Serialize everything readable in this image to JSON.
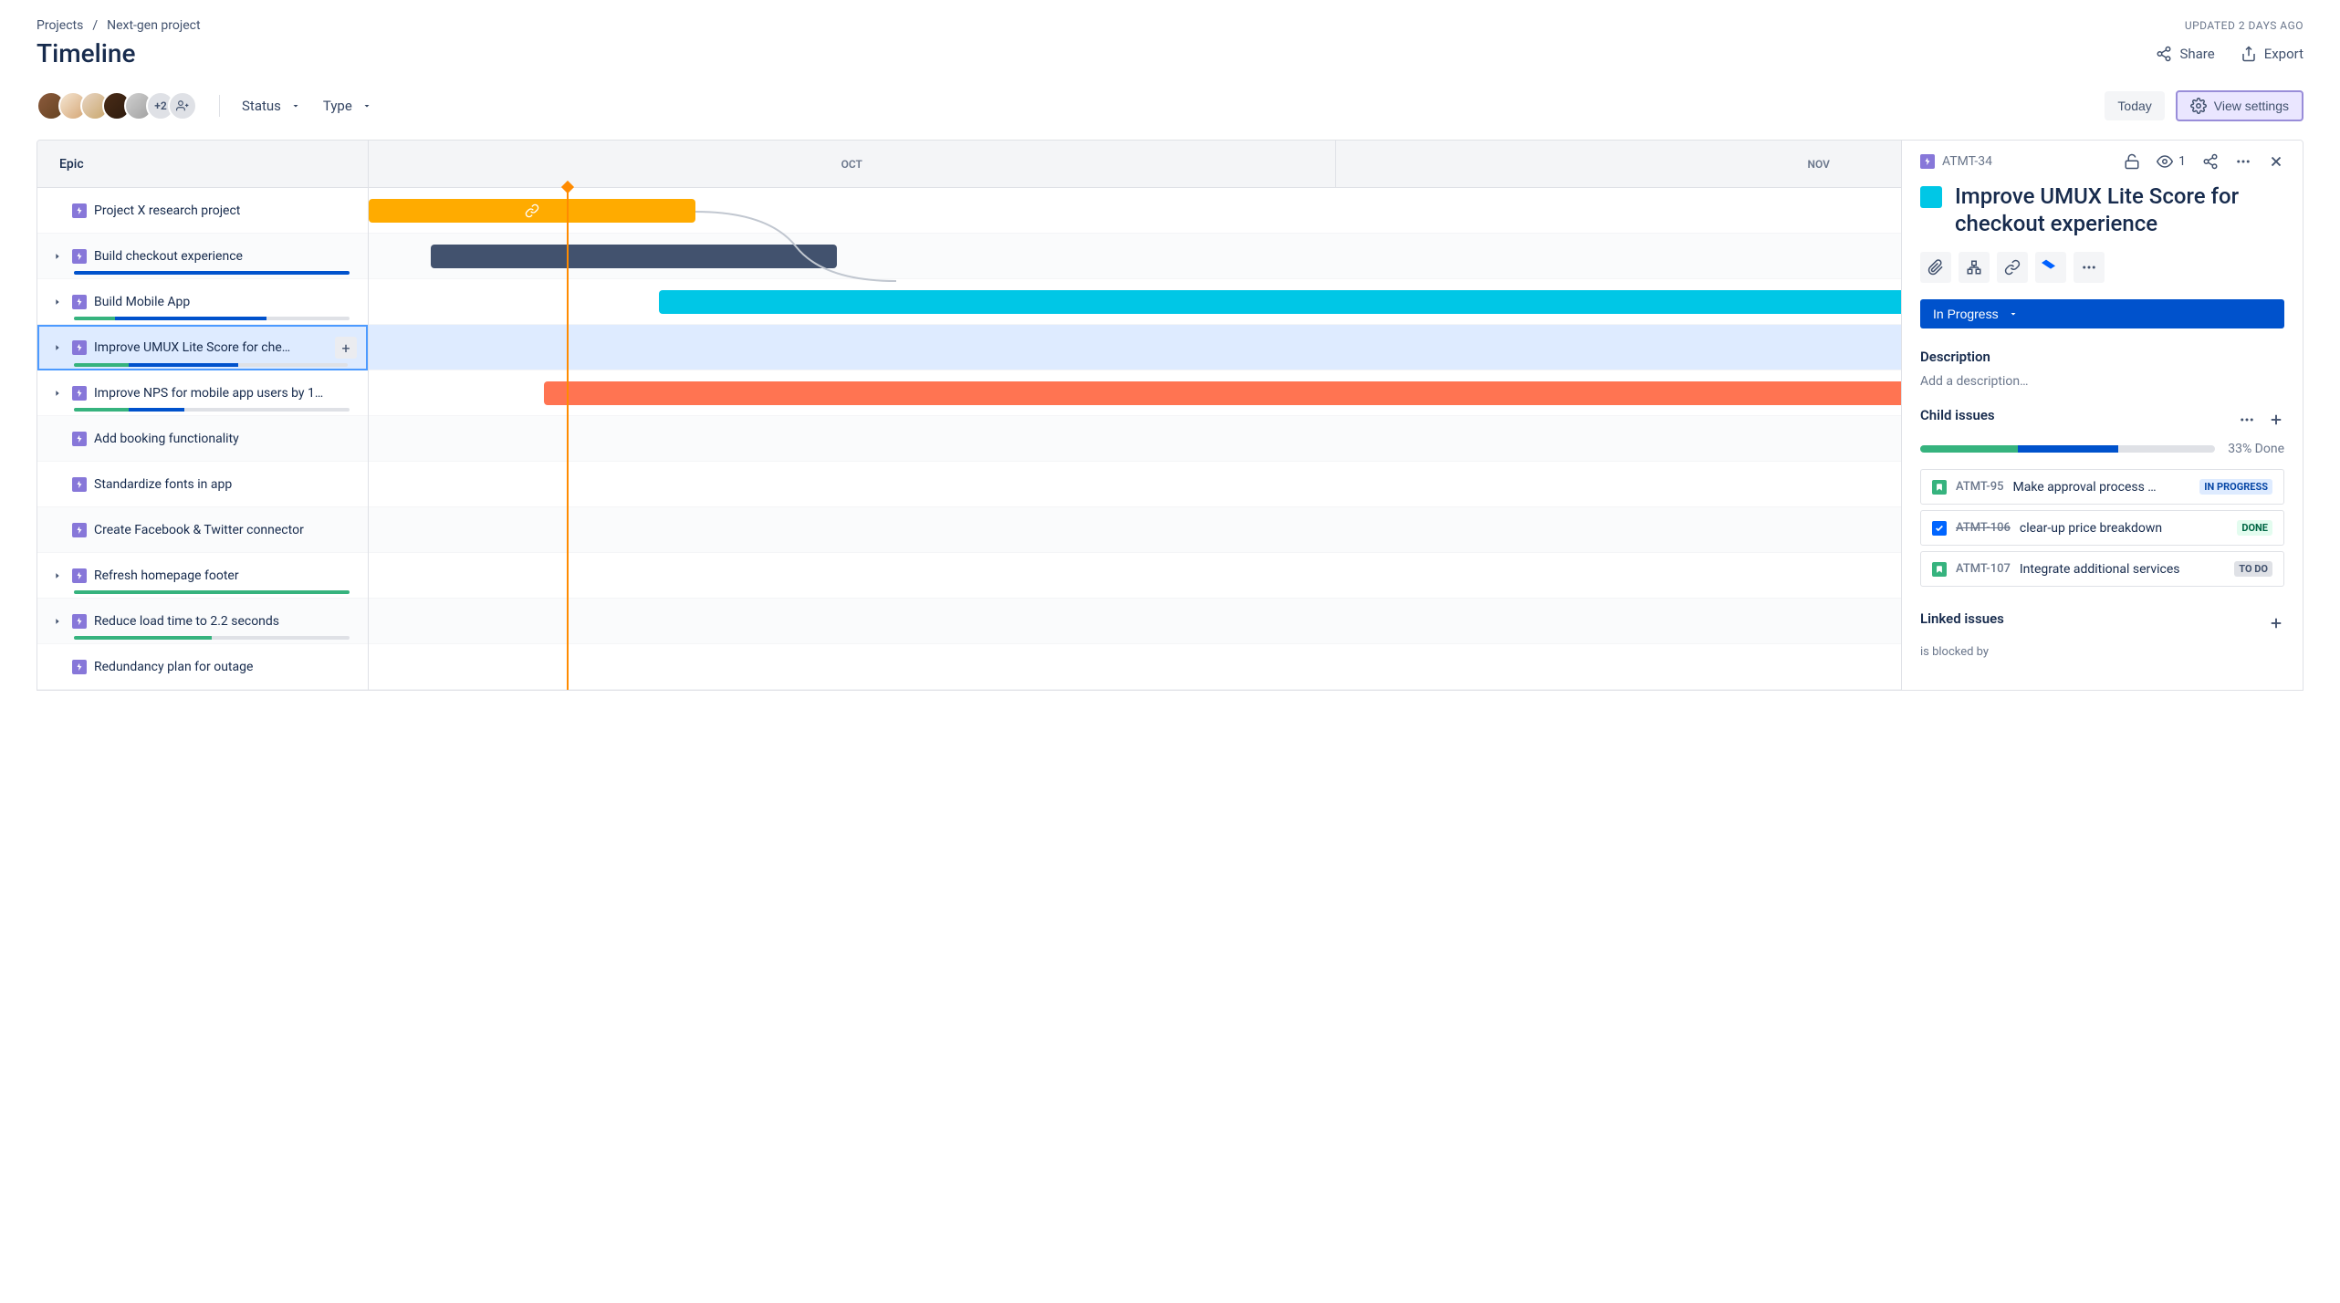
{
  "breadcrumb": {
    "projects": "Projects",
    "project": "Next-gen project"
  },
  "updated": "UPDATED 2 DAYS AGO",
  "title": "Timeline",
  "titleActions": {
    "share": "Share",
    "export": "Export"
  },
  "avatars": {
    "overflow": "+2"
  },
  "filters": {
    "status": "Status",
    "type": "Type"
  },
  "buttons": {
    "today": "Today",
    "viewSettings": "View settings"
  },
  "timeline": {
    "header": "Epic",
    "months": [
      "OCT",
      "NOV"
    ],
    "epics": [
      {
        "name": "Project X research project",
        "expandable": false,
        "progress": null
      },
      {
        "name": "Build checkout experience",
        "expandable": true,
        "progress": {
          "green": 0,
          "blue": 100,
          "gray": 0
        }
      },
      {
        "name": "Build Mobile App",
        "expandable": true,
        "progress": {
          "green": 15,
          "blue": 55,
          "gray": 30
        }
      },
      {
        "name": "Improve UMUX Lite Score for che…",
        "expandable": true,
        "selected": true,
        "progress": {
          "green": 20,
          "blue": 40,
          "gray": 40
        }
      },
      {
        "name": "Improve NPS for mobile app users by 1…",
        "expandable": true,
        "progress": {
          "green": 20,
          "blue": 20,
          "gray": 60
        }
      },
      {
        "name": "Add booking functionality",
        "expandable": false,
        "progress": null
      },
      {
        "name": "Standardize fonts in app",
        "expandable": false,
        "progress": null
      },
      {
        "name": "Create Facebook & Twitter connector",
        "expandable": false,
        "progress": null
      },
      {
        "name": "Refresh homepage footer",
        "expandable": true,
        "progress": {
          "green": 100,
          "blue": 0,
          "gray": 0
        }
      },
      {
        "name": "Reduce load time to 2.2 seconds",
        "expandable": true,
        "progress": {
          "green": 50,
          "blue": 0,
          "gray": 50
        }
      },
      {
        "name": "Redundancy plan for outage",
        "expandable": false,
        "progress": null
      }
    ]
  },
  "detail": {
    "key": "ATMT-34",
    "watchers": "1",
    "title": "Improve UMUX Lite Score for checkout experience",
    "status": "In Progress",
    "descLabel": "Description",
    "descPlaceholder": "Add a description…",
    "childLabel": "Child issues",
    "donePct": "33% Done",
    "childProgress": {
      "green": 33,
      "blue": 34,
      "gray": 33
    },
    "children": [
      {
        "type": "story",
        "key": "ATMT-95",
        "summary": "Make approval process …",
        "status": "IN PROGRESS",
        "statusClass": "sl-inprogress"
      },
      {
        "type": "task",
        "key": "ATMT-106",
        "summary": "clear-up price breakdown",
        "status": "DONE",
        "statusClass": "sl-done",
        "done": true
      },
      {
        "type": "story",
        "key": "ATMT-107",
        "summary": "Integrate additional services",
        "status": "TO DO",
        "statusClass": "sl-todo"
      }
    ],
    "linkedLabel": "Linked issues",
    "linkedSub": "is blocked by"
  }
}
